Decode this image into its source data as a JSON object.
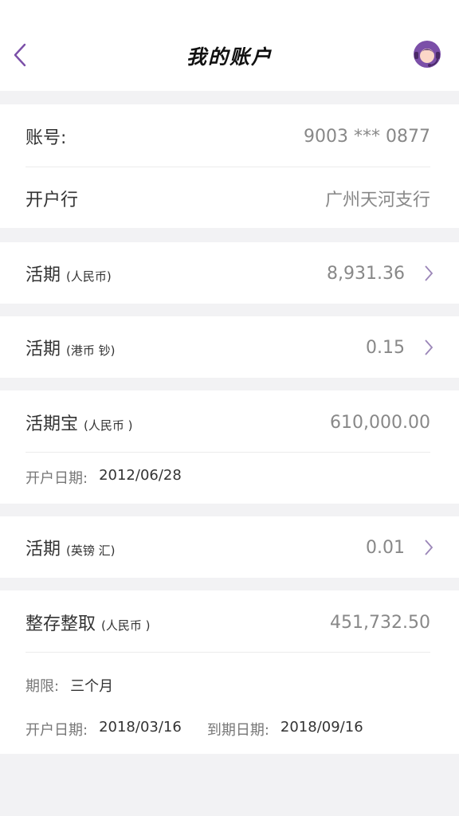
{
  "nav": {
    "title": "我的账户",
    "back_icon": "chevron-left-icon",
    "service_icon": "customer-service-icon",
    "accent": "#7b4fa8"
  },
  "account": {
    "number_label": "账号:",
    "number_value": "9003 *** 0877",
    "branch_label": "开户行",
    "branch_value": "广州天河支行"
  },
  "accounts": [
    {
      "name": "活期",
      "currency": "(人民币)",
      "amount": "8,931.36"
    },
    {
      "name": "活期",
      "currency": "(港币 钞)",
      "amount": "0.15"
    },
    {
      "name": "活期宝",
      "currency": "(人民币 )",
      "amount": "610,000.00",
      "open_date_label": "开户日期:",
      "open_date": "2012/06/28"
    },
    {
      "name": "活期",
      "currency": "(英镑 汇)",
      "amount": "0.01"
    },
    {
      "name": "整存整取",
      "currency": "(人民币 )",
      "amount": "451,732.50",
      "term_label": "期限:",
      "term": "三个月",
      "open_date_label": "开户日期:",
      "open_date": "2018/03/16",
      "due_date_label": "到期日期:",
      "due_date": "2018/09/16"
    }
  ]
}
